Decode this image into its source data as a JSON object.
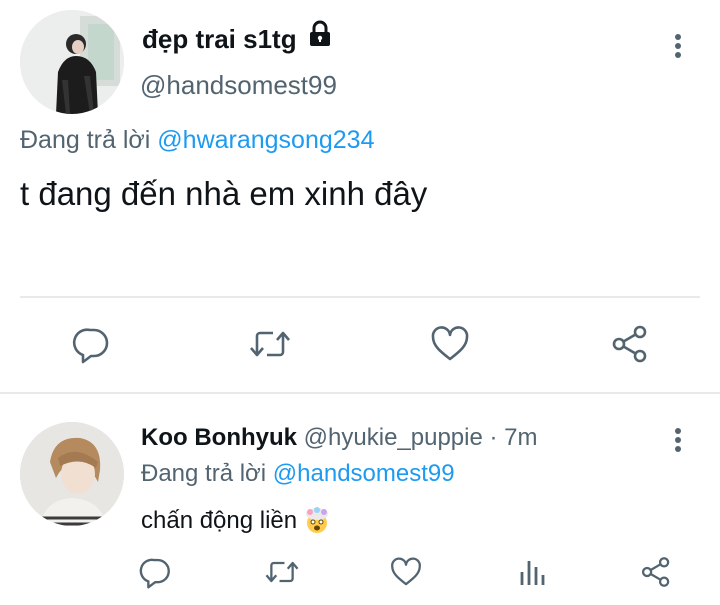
{
  "main_tweet": {
    "author_name": "đẹp trai s1tg",
    "handle": "@handsomest99",
    "replying_prefix": "Đang trả lời ",
    "replying_to": "@hwarangsong234",
    "text": "t đang đến nhà em xinh đây",
    "icons": [
      "lock-icon",
      "kebab-icon",
      "reply-icon",
      "retweet-icon",
      "like-icon",
      "share-icon"
    ]
  },
  "reply_tweet": {
    "author_name": "Koo Bonhyuk",
    "handle": "@hyukie_puppie",
    "separator": " · ",
    "time": "7m",
    "replying_prefix": "Đang trả lời ",
    "replying_to": "@handsomest99",
    "text": "chấn động liền",
    "emoji": "exploding-head-emoji",
    "icons": [
      "kebab-icon",
      "reply-icon",
      "retweet-icon",
      "like-icon",
      "analytics-icon",
      "share-icon"
    ]
  },
  "colors": {
    "text": "#0f1419",
    "secondary": "#536471",
    "link": "#1d9bf0",
    "divider": "#e7e9ea"
  }
}
